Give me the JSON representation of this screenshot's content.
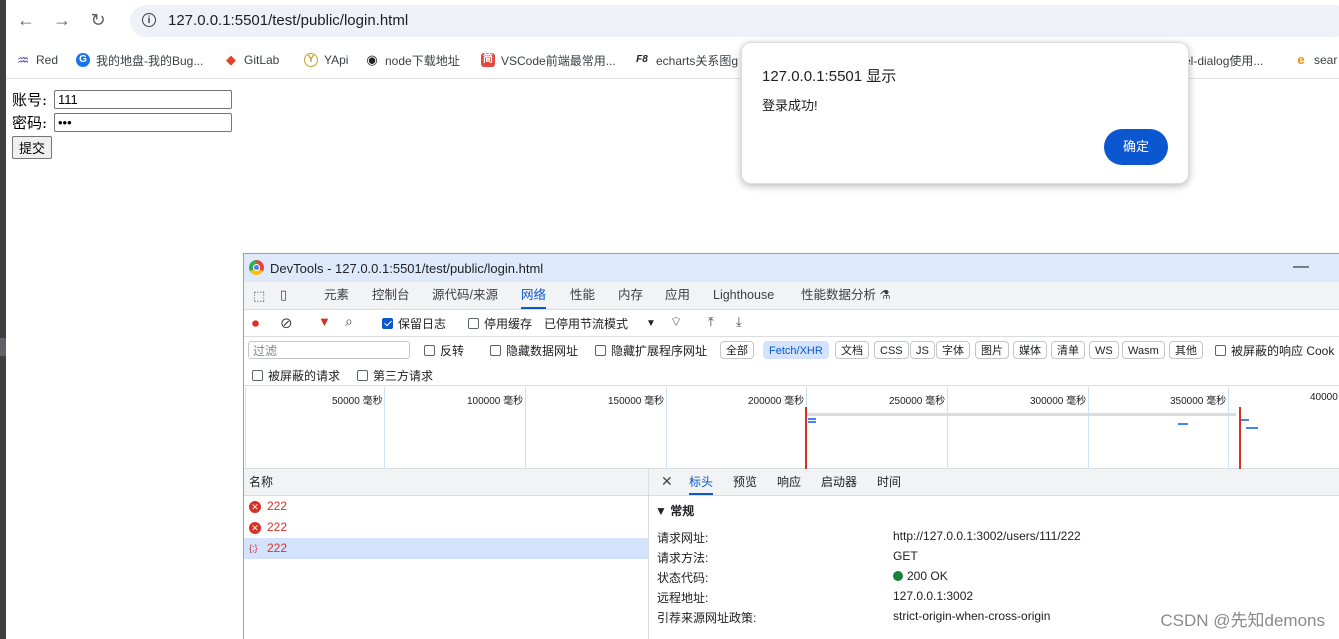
{
  "browser": {
    "url": "127.0.0.1:5501/test/public/login.html",
    "back_icon": "←",
    "forward_icon": "→",
    "reload_icon": "↻",
    "info_icon": "i"
  },
  "bookmarks": [
    {
      "label": "Red",
      "icon": "♒",
      "color": "#5f4ba0"
    },
    {
      "label": "我的地盘-我的Bug...",
      "icon": "G",
      "color": "#1a73e8"
    },
    {
      "label": "GitLab",
      "icon": "◆",
      "color": "#e24329"
    },
    {
      "label": "YApi",
      "icon": "Y",
      "color": "#c2a32c"
    },
    {
      "label": "node下载地址",
      "icon": "◉",
      "color": "#202124"
    },
    {
      "label": "VSCode前端最常用...",
      "icon": "简",
      "color": "#e8453c"
    },
    {
      "label": "echarts关系图g",
      "icon": "F8",
      "color": "#202124"
    },
    {
      "label": "el-dialog使用...",
      "icon": "",
      "color": "#ffffff"
    },
    {
      "label": "sear",
      "icon": "e",
      "color": "#f29111"
    }
  ],
  "form": {
    "account_label": "账号:",
    "account_value": "111",
    "password_label": "密码:",
    "password_value": "•••",
    "submit_label": "提交"
  },
  "dialog": {
    "title": "127.0.0.1:5501 显示",
    "message": "登录成功!",
    "ok_label": "确定"
  },
  "devtools": {
    "title": "DevTools - 127.0.0.1:5501/test/public/login.html",
    "minimize_icon": "—",
    "tabs": [
      "元素",
      "控制台",
      "源代码/来源",
      "网络",
      "性能",
      "内存",
      "应用",
      "Lighthouse",
      "性能数据分析 ⚗"
    ],
    "active_tab": "网络",
    "toolbar": {
      "preserve_log": "保留日志",
      "disable_cache": "停用缓存",
      "throttling": "已停用节流模式"
    },
    "filter": {
      "placeholder": "过滤",
      "invert": "反转",
      "hide_data_urls": "隐藏数据网址",
      "hide_extension_urls": "隐藏扩展程序网址",
      "types": [
        "全部",
        "Fetch/XHR",
        "文档",
        "CSS",
        "JS",
        "字体",
        "图片",
        "媒体",
        "清单",
        "WS",
        "Wasm",
        "其他"
      ],
      "active_type": "Fetch/XHR",
      "blocked_cookies": "被屏蔽的响应 Cook",
      "blocked_requests": "被屏蔽的请求",
      "third_party": "第三方请求"
    },
    "timeline_labels": [
      "50000 毫秒",
      "100000 毫秒",
      "150000 毫秒",
      "200000 毫秒",
      "250000 毫秒",
      "300000 毫秒",
      "350000 毫秒",
      "40000"
    ],
    "requests": {
      "header": "名称",
      "rows": [
        {
          "name": "222",
          "status": "error"
        },
        {
          "name": "222",
          "status": "error"
        },
        {
          "name": "222",
          "status": "xhr"
        }
      ]
    },
    "details": {
      "tabs": [
        "标头",
        "预览",
        "响应",
        "启动器",
        "时间"
      ],
      "active_tab": "标头",
      "section": "▼ 常规",
      "fields": [
        {
          "key": "请求网址:",
          "value": "http://127.0.0.1:3002/users/111/222"
        },
        {
          "key": "请求方法:",
          "value": "GET"
        },
        {
          "key": "状态代码:",
          "value": "200 OK"
        },
        {
          "key": "远程地址:",
          "value": "127.0.0.1:3002"
        },
        {
          "key": "引荐来源网址政策:",
          "value": "strict-origin-when-cross-origin"
        }
      ]
    }
  },
  "watermark": "CSDN @先知demons"
}
